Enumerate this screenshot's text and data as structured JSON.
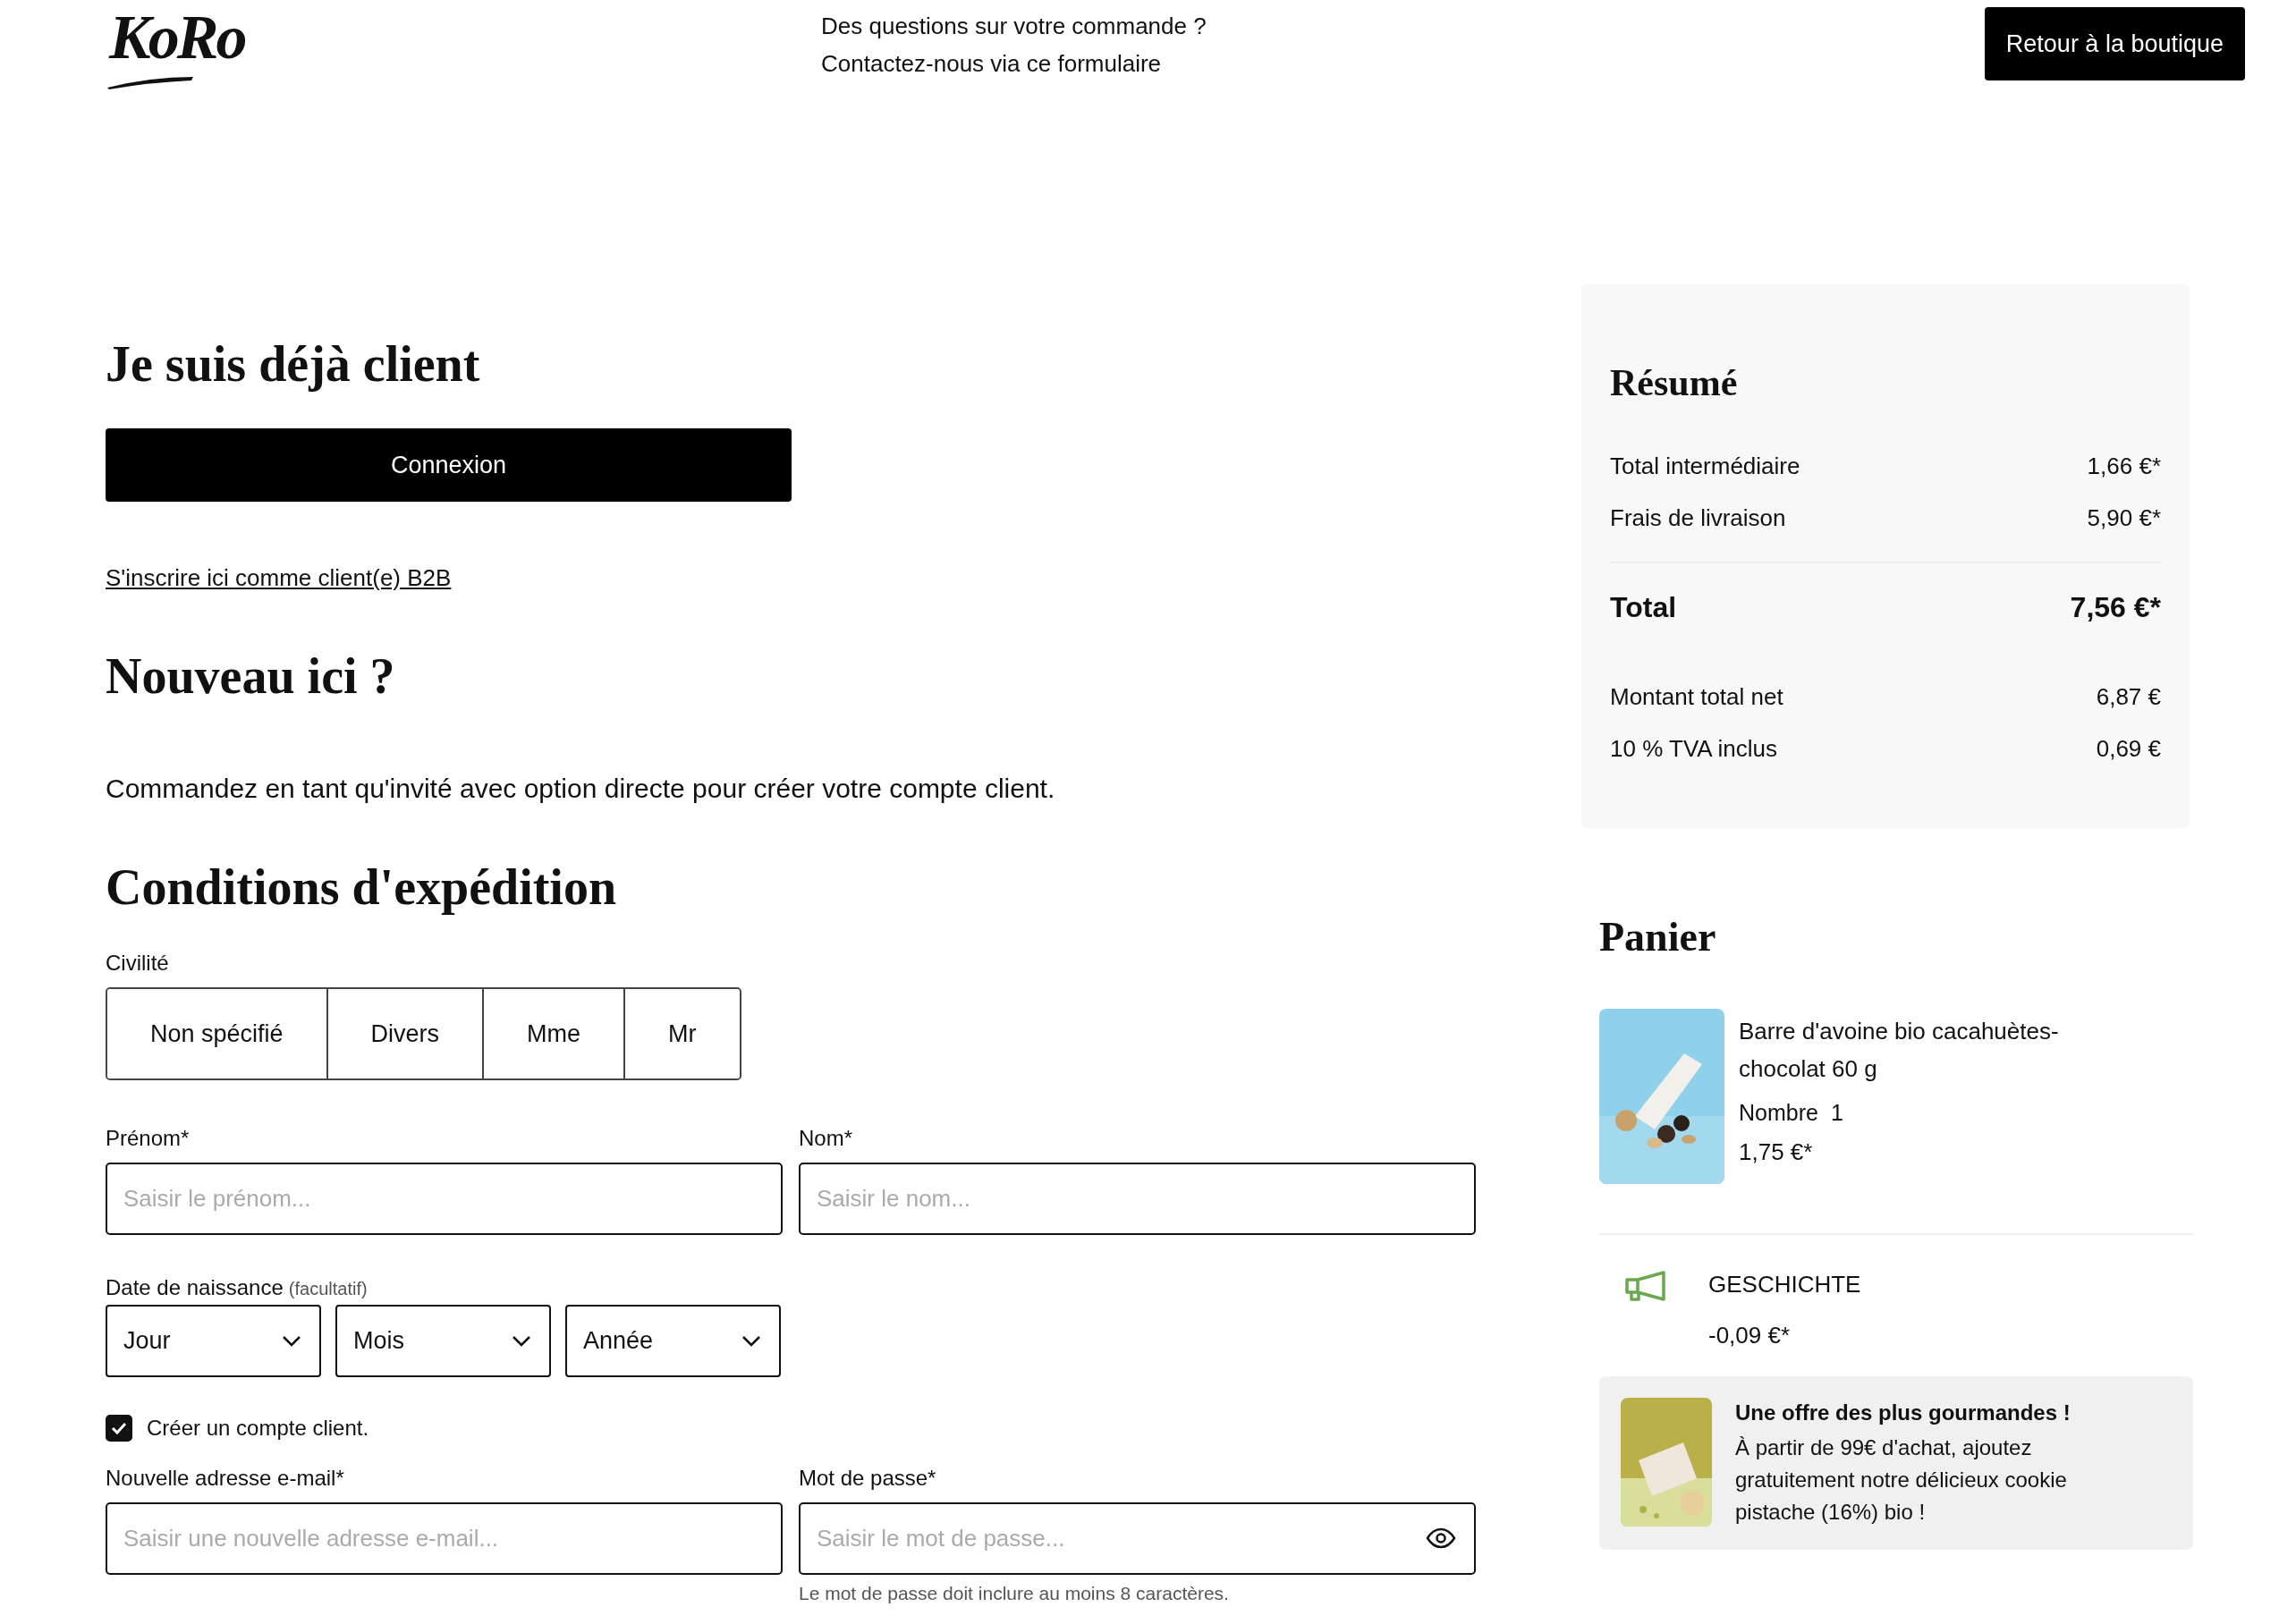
{
  "header": {
    "logo": "KoRo",
    "contact_lines": [
      "Des questions sur votre commande ?",
      "Contactez-nous via ce formulaire"
    ],
    "back_button": "Retour à la boutique"
  },
  "login": {
    "title": "Je suis déjà client",
    "button": "Connexion",
    "b2b_link": "S'inscrire ici comme client(e) B2B"
  },
  "new_customer": {
    "title": "Nouveau ici ?",
    "text": "Commandez en tant qu'invité avec option directe pour créer votre compte client."
  },
  "shipping": {
    "title": "Conditions d'expédition",
    "salutation_label": "Civilité",
    "salutations": [
      {
        "label": "Non spécifié",
        "selected": false
      },
      {
        "label": "Divers",
        "selected": false
      },
      {
        "label": "Mme",
        "selected": false
      },
      {
        "label": "Mr",
        "selected": false
      }
    ],
    "first_name": {
      "label": "Prénom*",
      "placeholder": "Saisir le prénom..."
    },
    "last_name": {
      "label": "Nom*",
      "placeholder": "Saisir le nom..."
    },
    "birthdate": {
      "label": "Date de naissance",
      "note": "(facultatif)",
      "selects": [
        "Jour",
        "Mois",
        "Année"
      ]
    },
    "create_account": {
      "label": "Créer un compte client.",
      "checked": true
    },
    "email": {
      "label": "Nouvelle adresse e-mail*",
      "placeholder": "Saisir une nouvelle adresse e-mail..."
    },
    "password": {
      "label": "Mot de passe*",
      "placeholder": "Saisir le mot de passe...",
      "hint": "Le mot de passe doit inclure au moins 8 caractères."
    }
  },
  "summary": {
    "title": "Résumé",
    "rows": [
      {
        "kind": "line",
        "label": "Total intermédiaire",
        "value": "1,66 €*"
      },
      {
        "kind": "line",
        "label": "Frais de livraison",
        "value": "5,90 €*"
      },
      {
        "kind": "total",
        "label": "Total",
        "value": "7,56 €*"
      },
      {
        "kind": "line",
        "label": "Montant total net",
        "value": "6,87 €"
      },
      {
        "kind": "line",
        "label": "10 % TVA inclus",
        "value": "0,69 €"
      }
    ]
  },
  "cart": {
    "title": "Panier",
    "items": [
      {
        "name": "Barre d'avoine bio cacahuètes-chocolat 60 g",
        "quantity_label": "Nombre",
        "quantity": "1",
        "price": "1,75 €*"
      }
    ],
    "discount": {
      "name": "GESCHICHTE",
      "value": "-0,09 €*"
    },
    "promo": {
      "title": "Une offre des plus gourmandes !",
      "text": "À partir de 99€ d'achat, ajoutez gratuitement notre délicieux cookie pistache (16%) bio !"
    }
  }
}
